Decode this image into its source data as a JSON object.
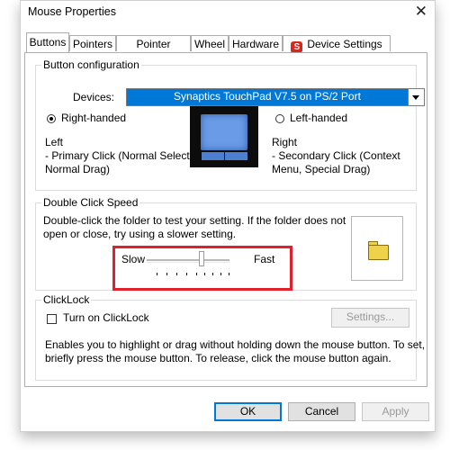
{
  "window": {
    "title": "Mouse Properties",
    "close_glyph": "✕"
  },
  "tabs": [
    {
      "label": "Buttons",
      "active": true
    },
    {
      "label": "Pointers"
    },
    {
      "label": "Pointer Options"
    },
    {
      "label": "Wheel"
    },
    {
      "label": "Hardware"
    },
    {
      "label": "Device Settings",
      "icon": "synaptics-icon"
    }
  ],
  "button_config": {
    "title": "Button configuration",
    "devices_label": "Devices:",
    "devices_value": "Synaptics TouchPad V7.5 on PS/2 Port",
    "right_handed": {
      "label": "Right-handed",
      "selected": true
    },
    "left_handed": {
      "label": "Left-handed",
      "selected": false
    },
    "left_desc": {
      "title": "Left",
      "line1": " - Primary Click (Normal Select,",
      "line2": "Normal Drag)"
    },
    "right_desc": {
      "title": "Right",
      "line1": " - Secondary Click (Context",
      "line2": "Menu, Special Drag)"
    }
  },
  "double_click": {
    "title": "Double Click Speed",
    "desc_line1": "Double-click the folder to test your setting.  If the folder does not",
    "desc_line2": "open or close, try using a slower setting.",
    "slow_label": "Slow",
    "fast_label": "Fast",
    "speed_level": 0.6
  },
  "clicklock": {
    "title": "ClickLock",
    "checkbox_label": "Turn on ClickLock",
    "checked": false,
    "settings_label": "Settings...",
    "desc_line1": "Enables you to highlight or drag without holding down the mouse button.  To set,",
    "desc_line2": "briefly press the mouse button.  To release, click the mouse button again."
  },
  "footer": {
    "ok_label": "OK",
    "cancel_label": "Cancel",
    "apply_label": "Apply"
  },
  "colors": {
    "highlight": "#0078d7",
    "annotation": "#e0202a",
    "folder": "#f0d24a",
    "touchpad": "#6a9be6"
  }
}
